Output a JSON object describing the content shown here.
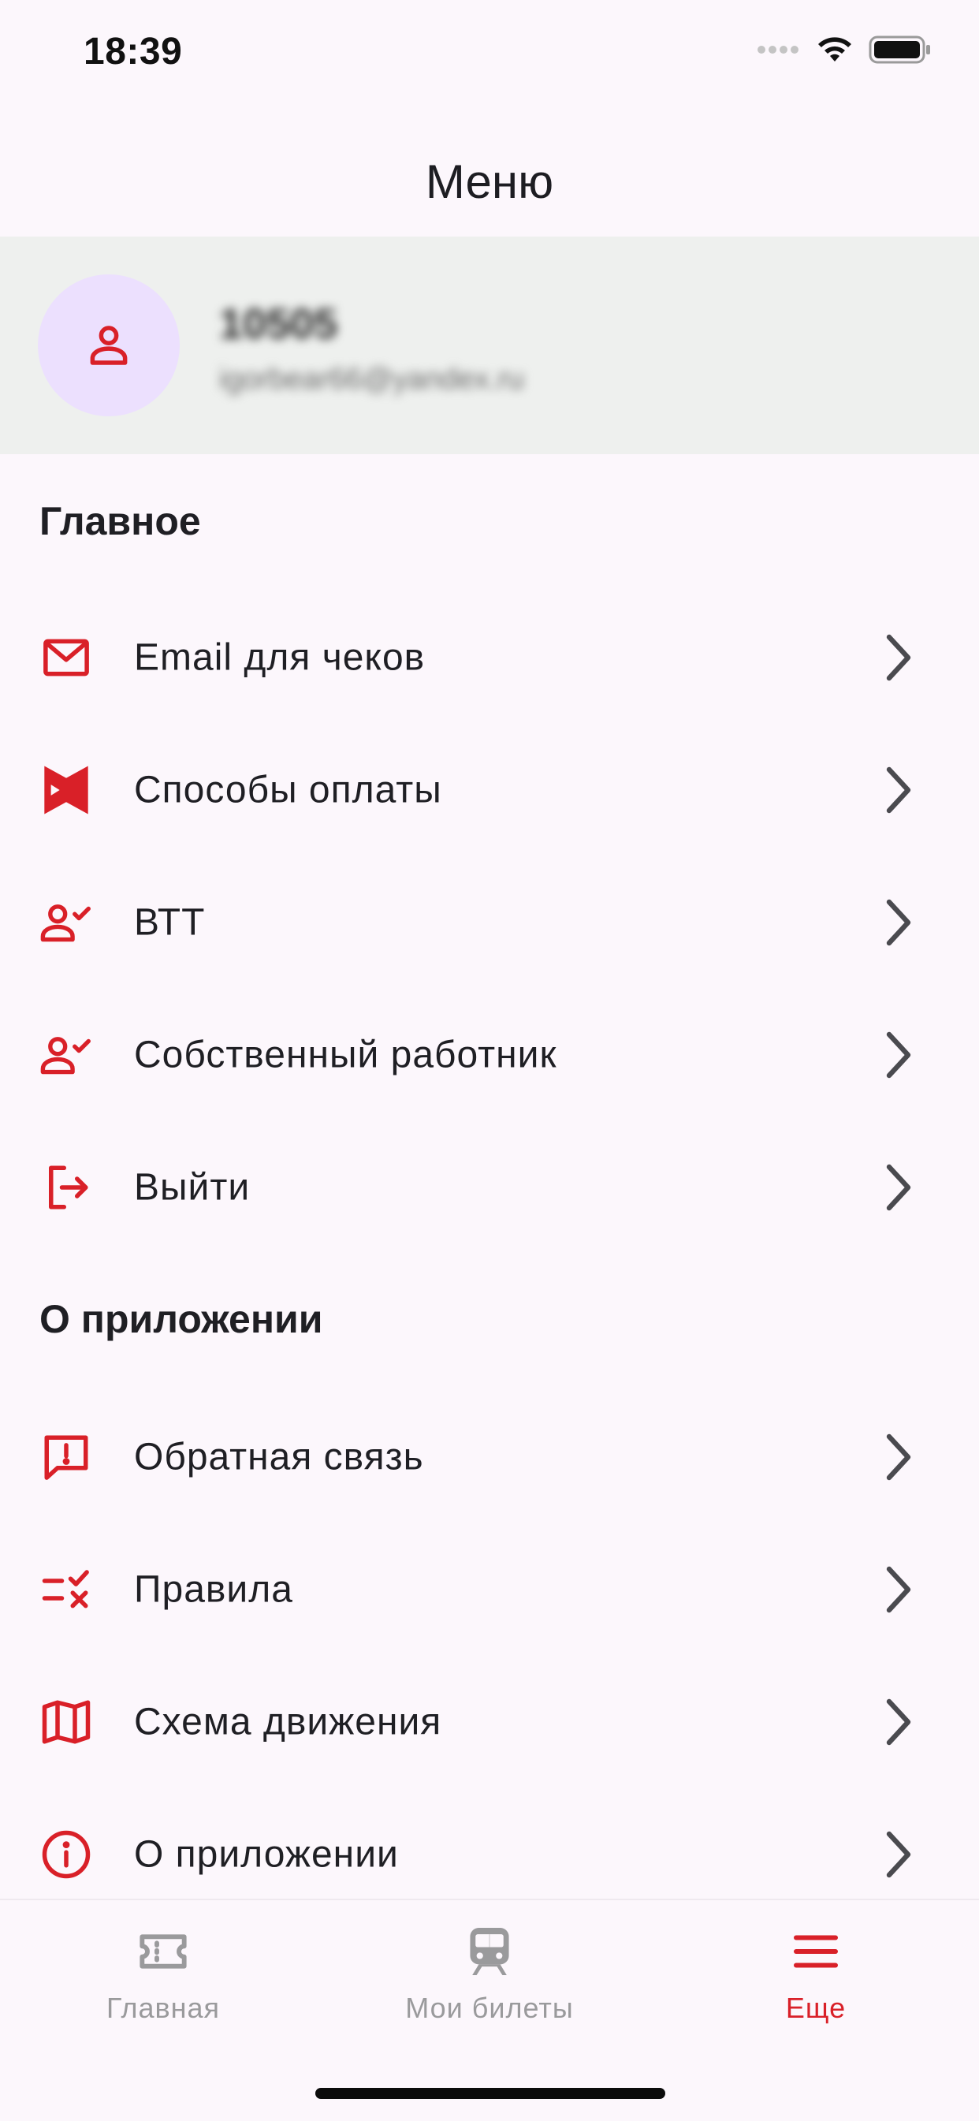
{
  "status_bar": {
    "time": "18:39"
  },
  "header": {
    "title": "Меню"
  },
  "profile": {
    "name": "10505",
    "email": "igorbear66@yandex.ru"
  },
  "sections": {
    "main": {
      "title": "Главное",
      "items": [
        {
          "label": "Email для чеков",
          "icon": "mail-icon"
        },
        {
          "label": "Способы оплаты",
          "icon": "payment-icon"
        },
        {
          "label": "ВТТ",
          "icon": "user-check-icon"
        },
        {
          "label": "Собственный работник",
          "icon": "user-check-icon"
        },
        {
          "label": "Выйти",
          "icon": "logout-icon"
        }
      ]
    },
    "about": {
      "title": "О приложении",
      "items": [
        {
          "label": "Обратная связь",
          "icon": "feedback-icon"
        },
        {
          "label": "Правила",
          "icon": "rules-icon"
        },
        {
          "label": "Схема движения",
          "icon": "map-icon"
        },
        {
          "label": "О приложении",
          "icon": "info-icon"
        }
      ]
    }
  },
  "tab_bar": {
    "tabs": [
      {
        "label": "Главная",
        "icon": "ticket-icon",
        "active": false
      },
      {
        "label": "Мои билеты",
        "icon": "train-icon",
        "active": false
      },
      {
        "label": "Еще",
        "icon": "menu-icon",
        "active": true
      }
    ]
  },
  "colors": {
    "accent": "#d92028",
    "background": "#fcf7fc",
    "profile_bg": "#eef0ee",
    "avatar_bg": "#ece0fe",
    "inactive": "#9a9a9c"
  }
}
